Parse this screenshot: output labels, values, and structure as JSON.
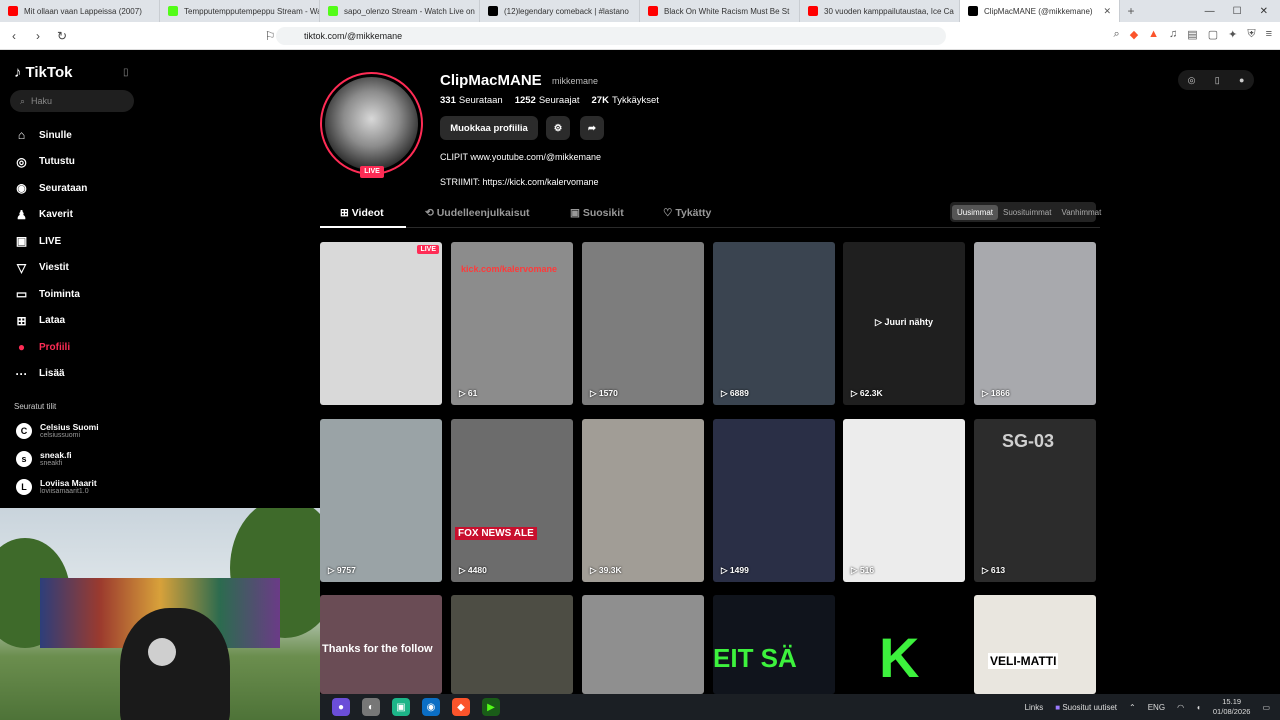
{
  "browser": {
    "tabs": [
      {
        "title": "Mit ollaan vaan Lappeissa (2007)",
        "color": "#ff0000"
      },
      {
        "title": "Tempputempputempeppu Stream - Watch Live",
        "color": "#53fc18"
      },
      {
        "title": "sapo_olenzo Stream - Watch Live on",
        "color": "#53fc18"
      },
      {
        "title": "(12)legendary comeback | #lastano",
        "color": "#000000"
      },
      {
        "title": "Black On White Racism Must Be St",
        "color": "#ff0000"
      },
      {
        "title": "30 vuoden kamppailutaustaa, Ice Ca",
        "color": "#ff0000"
      },
      {
        "title": "ClipMacMANE (@mikkemane)",
        "color": "#000000",
        "close": "✕"
      }
    ],
    "new_tab": "+",
    "url": "tiktok.com/@mikkemane"
  },
  "sidebar": {
    "logo": "TikTok",
    "search_placeholder": "Haku",
    "nav": [
      {
        "label": "Sinulle",
        "icon": "⌂"
      },
      {
        "label": "Tutustu",
        "icon": "◎"
      },
      {
        "label": "Seurataan",
        "icon": "◉"
      },
      {
        "label": "Kaverit",
        "icon": "♟"
      },
      {
        "label": "LIVE",
        "icon": "▣"
      },
      {
        "label": "Viestit",
        "icon": "▽"
      },
      {
        "label": "Toiminta",
        "icon": "▭"
      },
      {
        "label": "Lataa",
        "icon": "⊞"
      },
      {
        "label": "Profiili",
        "icon": "●"
      },
      {
        "label": "Lisää",
        "icon": "···"
      }
    ],
    "followed_title": "Seuratut tilit",
    "accounts": [
      {
        "name": "Celsius Suomi",
        "handle": "celsiussuomi",
        "initial": "C"
      },
      {
        "name": "sneak.fi",
        "handle": "sneakfi",
        "initial": "s"
      },
      {
        "name": "Loviisa Maarit",
        "handle": "loviisamaarit1.0",
        "initial": "L"
      }
    ]
  },
  "profile": {
    "name": "ClipMacMANE",
    "handle": "mikkemane",
    "live_label": "LIVE",
    "stats": [
      {
        "value": "331",
        "label": "Seurataan"
      },
      {
        "value": "1252",
        "label": "Seuraajat"
      },
      {
        "value": "27K",
        "label": "Tykkäykset"
      }
    ],
    "edit_button": "Muokkaa profiilia",
    "bio_line1": "CLIPIT www.youtube.com/@mikkemane",
    "bio_line2": "STRIIMIT: https://kick.com/kalervomane",
    "tabs": [
      "Videot",
      "Uudelleenjulkaisut",
      "Suosikit",
      "Tykätty"
    ],
    "sort": [
      "Uusimmat",
      "Suosituimmat",
      "Vanhimmat"
    ]
  },
  "videos": [
    {
      "views": "",
      "live": "LIVE",
      "bg": "#d9d9d9"
    },
    {
      "views": "61",
      "overlay": "kick.com/kalervomane",
      "bg": "#8c8c8c"
    },
    {
      "views": "1570",
      "bg": "#7d7d7d"
    },
    {
      "views": "6889",
      "bg": "#3a4450"
    },
    {
      "views": "62.3K",
      "center": "▷ Juuri nähty",
      "bg": "#1f1f1f"
    },
    {
      "views": "1866",
      "bg": "#a8a9ad"
    },
    {
      "views": "9757",
      "bg": "#9aa3a6"
    },
    {
      "views": "4480",
      "overlay": "FOX NEWS ALE",
      "bg": "#6c6c6c"
    },
    {
      "views": "39.3K",
      "bg": "#a19d96"
    },
    {
      "views": "1499",
      "bg": "#2a2f46"
    },
    {
      "views": "516",
      "bg": "#ececec"
    },
    {
      "views": "613",
      "overlay": "SG-03",
      "bg": "#2c2c2c"
    },
    {
      "views": "",
      "overlay": "Thanks for the follow",
      "bg": "#6a4c55"
    },
    {
      "views": "",
      "bg": "#4d4d44"
    },
    {
      "views": "",
      "bg": "#8f8f8f"
    },
    {
      "views": "",
      "overlay": "EIT SÄ",
      "bg": "#10141c"
    },
    {
      "views": "",
      "overlay": "K",
      "bg": "#000000"
    },
    {
      "views": "",
      "overlay": "VELI-MATTI",
      "bg": "#e9e6df"
    }
  ],
  "taskbar": {
    "links": "Links",
    "news": "Suositut uutiset",
    "lang": "ENG",
    "time": "15.19",
    "date": "01/08/2026"
  }
}
